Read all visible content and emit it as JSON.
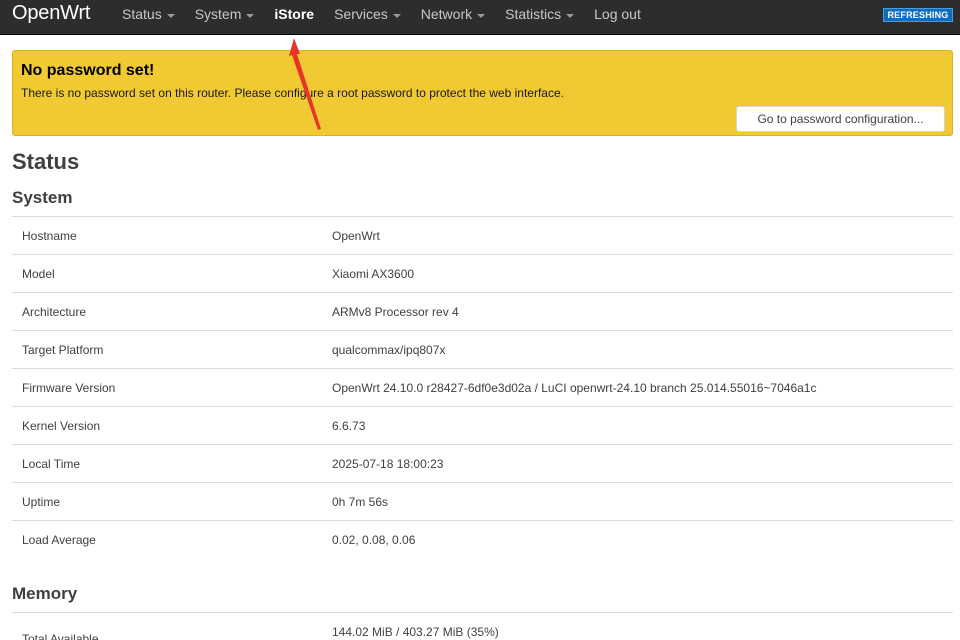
{
  "navbar": {
    "brand": "OpenWrt",
    "menu": [
      {
        "label": "Status",
        "dropdown": true
      },
      {
        "label": "System",
        "dropdown": true
      },
      {
        "label": "iStore",
        "dropdown": false
      },
      {
        "label": "Services",
        "dropdown": true
      },
      {
        "label": "Network",
        "dropdown": true
      },
      {
        "label": "Statistics",
        "dropdown": true
      },
      {
        "label": "Log out",
        "dropdown": false
      }
    ],
    "refresh_badge": "REFRESHING"
  },
  "alert": {
    "title": "No password set!",
    "text": "There is no password set on this router. Please configure a root password to protect the web interface.",
    "button": "Go to password configuration..."
  },
  "page_title": "Status",
  "system": {
    "heading": "System",
    "rows": [
      {
        "key": "Hostname",
        "value": "OpenWrt"
      },
      {
        "key": "Model",
        "value": "Xiaomi AX3600"
      },
      {
        "key": "Architecture",
        "value": "ARMv8 Processor rev 4"
      },
      {
        "key": "Target Platform",
        "value": "qualcommax/ipq807x"
      },
      {
        "key": "Firmware Version",
        "value": "OpenWrt 24.10.0 r28427-6df0e3d02a / LuCI openwrt-24.10 branch 25.014.55016~7046a1c"
      },
      {
        "key": "Kernel Version",
        "value": "6.6.73"
      },
      {
        "key": "Local Time",
        "value": "2025-07-18 18:00:23"
      },
      {
        "key": "Uptime",
        "value": "0h 7m 56s"
      },
      {
        "key": "Load Average",
        "value": "0.02, 0.08, 0.06"
      }
    ]
  },
  "memory": {
    "heading": "Memory",
    "rows": [
      {
        "key": "Total Available",
        "value": "144.02 MiB / 403.27 MiB (35%)"
      }
    ]
  },
  "colors": {
    "navbar": "#2d2d2d",
    "alert": "#f1c933",
    "badge": "#0f6dbf",
    "arrow": "#e8352a"
  }
}
